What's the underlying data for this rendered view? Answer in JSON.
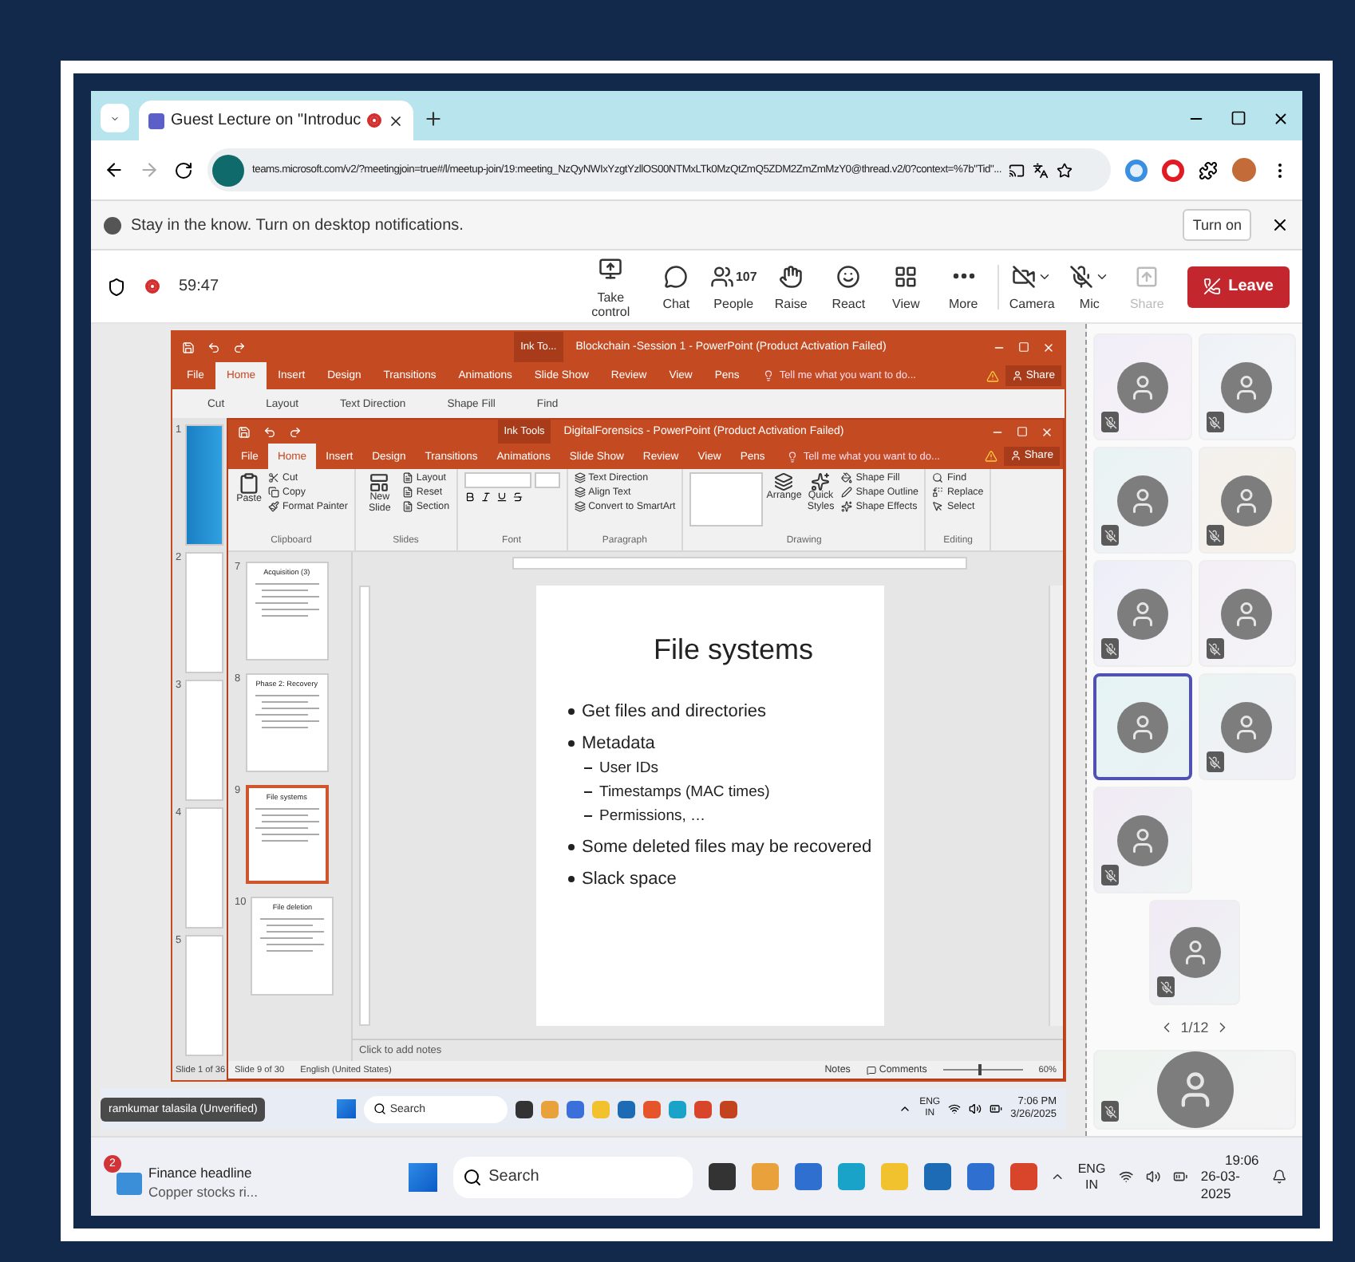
{
  "browser": {
    "tab": {
      "title": "Guest Lecture on \"Introduc",
      "recording": true
    },
    "url": "teams.microsoft.com/v2/?meetingjoin=true#/l/meetup-join/19:meeting_NzQyNWIxYzgtYzllOS00NTMxLTk0MzQtZmQ5ZDM2ZmZmMzY0@thread.v2/0?context=%7b\"Tid\"..."
  },
  "notification": {
    "text": "Stay in the know. Turn on desktop notifications.",
    "button": "Turn on"
  },
  "meeting": {
    "timer": "59:47",
    "recording": true,
    "controls": [
      {
        "label": "Take control",
        "disabled": false,
        "dropdown": false
      },
      {
        "label": "Chat",
        "disabled": false,
        "dropdown": false
      },
      {
        "label": "People",
        "count": "107",
        "disabled": false,
        "dropdown": false
      },
      {
        "label": "Raise",
        "disabled": false,
        "dropdown": false
      },
      {
        "label": "React",
        "disabled": false,
        "dropdown": false
      },
      {
        "label": "View",
        "disabled": false,
        "dropdown": false
      },
      {
        "label": "More",
        "disabled": false,
        "dropdown": false
      },
      {
        "label": "Camera",
        "disabled": false,
        "dropdown": true
      },
      {
        "label": "Mic",
        "disabled": false,
        "dropdown": true
      },
      {
        "label": "Share",
        "disabled": true,
        "dropdown": false
      }
    ],
    "leave": "Leave"
  },
  "powerpoint_back": {
    "title": "Blockchain -Session 1 - PowerPoint (Product Activation Failed)",
    "context_tab": "Ink To...",
    "tabs": [
      {
        "label": "File",
        "selected": false
      },
      {
        "label": "Home",
        "selected": true
      },
      {
        "label": "Insert",
        "selected": false
      },
      {
        "label": "Design",
        "selected": false
      },
      {
        "label": "Transitions",
        "selected": false
      },
      {
        "label": "Animations",
        "selected": false
      },
      {
        "label": "Slide Show",
        "selected": false
      },
      {
        "label": "Review",
        "selected": false
      },
      {
        "label": "View",
        "selected": false
      },
      {
        "label": "Pens",
        "selected": false
      }
    ],
    "tell_me": "Tell me what you want to do...",
    "share": "Share",
    "ribbon_peek": [
      "Cut",
      "Layout",
      "Text Direction",
      "Shape Fill",
      "Find"
    ],
    "slide_numbers": [
      "1",
      "2",
      "3",
      "4",
      "5"
    ],
    "status": "Slide 1 of 36"
  },
  "powerpoint_front": {
    "title": "DigitalForensics - PowerPoint (Product Activation Failed)",
    "context_tab": "Ink Tools",
    "tabs": [
      {
        "label": "File",
        "selected": false
      },
      {
        "label": "Home",
        "selected": true
      },
      {
        "label": "Insert",
        "selected": false
      },
      {
        "label": "Design",
        "selected": false
      },
      {
        "label": "Transitions",
        "selected": false
      },
      {
        "label": "Animations",
        "selected": false
      },
      {
        "label": "Slide Show",
        "selected": false
      },
      {
        "label": "Review",
        "selected": false
      },
      {
        "label": "View",
        "selected": false
      },
      {
        "label": "Pens",
        "selected": false
      }
    ],
    "tell_me": "Tell me what you want to do...",
    "share": "Share",
    "ribbon": [
      {
        "name": "Clipboard",
        "items": [
          "Paste",
          "Cut",
          "Copy",
          "Format Painter"
        ]
      },
      {
        "name": "Slides",
        "items": [
          "New Slide",
          "Layout",
          "Reset",
          "Section"
        ]
      },
      {
        "name": "Font"
      },
      {
        "name": "Paragraph",
        "items": [
          "Text Direction",
          "Align Text",
          "Convert to SmartArt"
        ]
      },
      {
        "name": "Drawing",
        "items": [
          "Arrange",
          "Quick Styles",
          "Shape Fill",
          "Shape Outline",
          "Shape Effects"
        ]
      },
      {
        "name": "Editing",
        "items": [
          "Find",
          "Replace",
          "Select"
        ]
      }
    ],
    "thumbnails": [
      {
        "number": "7",
        "title": "Acquisition (3)",
        "selected": false
      },
      {
        "number": "8",
        "title": "Phase 2: Recovery",
        "selected": false
      },
      {
        "number": "9",
        "title": "File systems",
        "selected": true
      },
      {
        "number": "10",
        "title": "File deletion",
        "selected": false
      }
    ],
    "slide": {
      "title": "File systems",
      "bullets": [
        {
          "text": "Get files and directories"
        },
        {
          "text": "Metadata",
          "children": [
            {
              "text": "User IDs"
            },
            {
              "text": "Timestamps (MAC times)"
            },
            {
              "text": "Permissions, …"
            }
          ]
        },
        {
          "text": "Some deleted files may be recovered"
        },
        {
          "text": "Slack space"
        }
      ]
    },
    "notes_placeholder": "Click to add notes",
    "status": {
      "slide": "Slide 9 of 30",
      "language": "English (United States)",
      "notes": "Notes",
      "comments": "Comments",
      "zoom": "60%",
      "zoom_slider": {
        "level": 0.45
      }
    }
  },
  "shared_taskbar": {
    "presenter": "ramkumar talasila (Unverified)",
    "search_placeholder": "Search",
    "language": [
      "ENG",
      "IN"
    ],
    "time": "7:06 PM",
    "date": "3/26/2025"
  },
  "participants": {
    "tiles": [
      {
        "selected": false,
        "muted": true
      },
      {
        "selected": false,
        "muted": true
      },
      {
        "selected": false,
        "muted": true
      },
      {
        "selected": false,
        "muted": true
      },
      {
        "selected": false,
        "muted": true
      },
      {
        "selected": false,
        "muted": true
      },
      {
        "selected": true,
        "muted": false
      },
      {
        "selected": false,
        "muted": true
      },
      {
        "selected": false,
        "muted": true
      }
    ],
    "page": "1/12",
    "featured": {
      "muted": true
    }
  },
  "taskbar": {
    "widget": {
      "badge": "2",
      "title": "Finance headline",
      "subtitle": "Copper stocks ri..."
    },
    "search_placeholder": "Search",
    "language": [
      "ENG",
      "IN"
    ],
    "time": "19:06",
    "date": "26-03-2025"
  }
}
